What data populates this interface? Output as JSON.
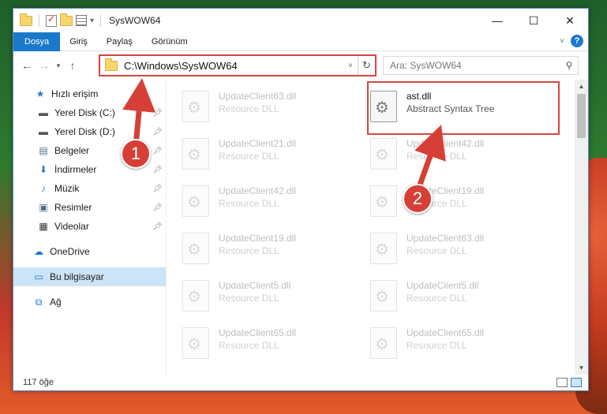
{
  "window": {
    "title": "SysWOW64",
    "controls": {
      "minimize": "—",
      "maximize": "☐",
      "close": "✕"
    }
  },
  "ribbon": {
    "tabs": [
      "Dosya",
      "Giriş",
      "Paylaş",
      "Görünüm"
    ],
    "active_tab": "Dosya",
    "help": "?"
  },
  "address": {
    "path": "C:\\Windows\\SysWOW64",
    "search_placeholder": "Ara: SysWOW64"
  },
  "sidebar": {
    "quick_access": "Hızlı erişim",
    "items": [
      {
        "label": "Yerel Disk (C:)",
        "icon": "drive-icon"
      },
      {
        "label": "Yerel Disk (D:)",
        "icon": "drive-icon"
      },
      {
        "label": "Belgeler",
        "icon": "documents-icon"
      },
      {
        "label": "İndirmeler",
        "icon": "downloads-icon"
      },
      {
        "label": "Müzik",
        "icon": "music-icon"
      },
      {
        "label": "Resimler",
        "icon": "pictures-icon"
      },
      {
        "label": "Videolar",
        "icon": "videos-icon"
      }
    ],
    "onedrive": "OneDrive",
    "this_pc": "Bu bilgisayar",
    "network": "Ağ"
  },
  "files": [
    {
      "name": "UpdateClient63.dll",
      "desc": "Resource DLL"
    },
    {
      "name": "ast.dll",
      "desc": "Abstract Syntax Tree"
    },
    {
      "name": "UpdateClient21.dll",
      "desc": "Resource DLL"
    },
    {
      "name": "UpdateClient42.dll",
      "desc": "Resource DLL"
    },
    {
      "name": "UpdateClient42.dll",
      "desc": "Resource DLL"
    },
    {
      "name": "UpdateClient19.dll",
      "desc": "Resource DLL"
    },
    {
      "name": "UpdateClient19.dll",
      "desc": "Resource DLL"
    },
    {
      "name": "UpdateClient63.dll",
      "desc": "Resource DLL"
    },
    {
      "name": "UpdateClient5.dll",
      "desc": "Resource DLL"
    },
    {
      "name": "UpdateClient5.dll",
      "desc": "Resource DLL"
    },
    {
      "name": "UpdateClient65.dll",
      "desc": "Resource DLL"
    },
    {
      "name": "UpdateClient65.dll",
      "desc": "Resource DLL"
    }
  ],
  "status": {
    "count": "117 öğe"
  },
  "annotations": {
    "step1": "1",
    "step2": "2",
    "color": "#d63f35"
  }
}
